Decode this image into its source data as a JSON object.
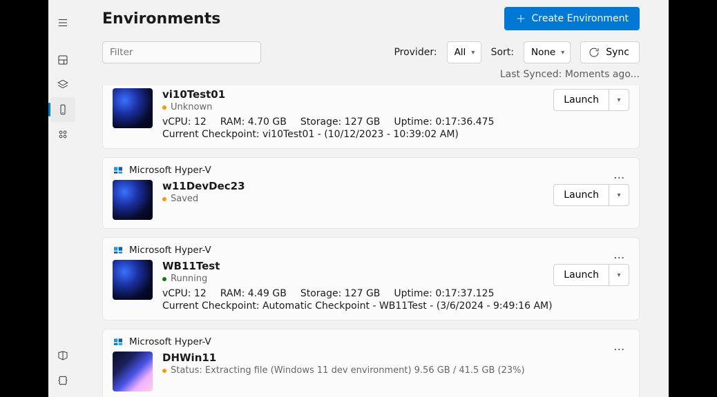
{
  "page": {
    "title": "Environments",
    "createLabel": "Create Environment",
    "filterPlaceholder": "Filter",
    "providerLabel": "Provider:",
    "providerValue": "All",
    "sortLabel": "Sort:",
    "sortValue": "None",
    "syncLabel": "Sync",
    "lastSynced": "Last Synced: Moments ago...",
    "launchLabel": "Launch"
  },
  "envs": [
    {
      "providerHidden": true,
      "more": "…",
      "name": "vi10Test01",
      "statusDot": "orange",
      "status": "Unknown",
      "vcpuLabel": "vCPU:",
      "vcpu": "12",
      "ramLabel": "RAM:",
      "ram": "4.70 GB",
      "storageLabel": "Storage:",
      "storage": "127 GB",
      "uptimeLabel": "Uptime:",
      "uptime": "0:17:36.475",
      "checkpointLabel": "Current Checkpoint:",
      "checkpoint": "vi10Test01 - (10/12/2023 - 10:39:02 AM)"
    },
    {
      "provider": "Microsoft Hyper-V",
      "more": "…",
      "name": "w11DevDec23",
      "statusDot": "gray",
      "status": "Saved"
    },
    {
      "provider": "Microsoft Hyper-V",
      "more": "…",
      "name": "WB11Test",
      "statusDot": "green",
      "status": "Running",
      "vcpuLabel": "vCPU:",
      "vcpu": "12",
      "ramLabel": "RAM:",
      "ram": "4.49 GB",
      "storageLabel": "Storage:",
      "storage": "127 GB",
      "uptimeLabel": "Uptime:",
      "uptime": "0:17:37.125",
      "checkpointLabel": "Current Checkpoint:",
      "checkpoint": "Automatic Checkpoint - WB11Test - (3/6/2024 - 9:49:16 AM)"
    },
    {
      "provider": "Microsoft Hyper-V",
      "more": "…",
      "name": "DHWin11",
      "thumbAlt": true,
      "statusDot": "orange",
      "status": "Status: Extracting file (Windows 11 dev environment) 9.56 GB / 41.5 GB (23%)",
      "noLaunch": true
    }
  ]
}
